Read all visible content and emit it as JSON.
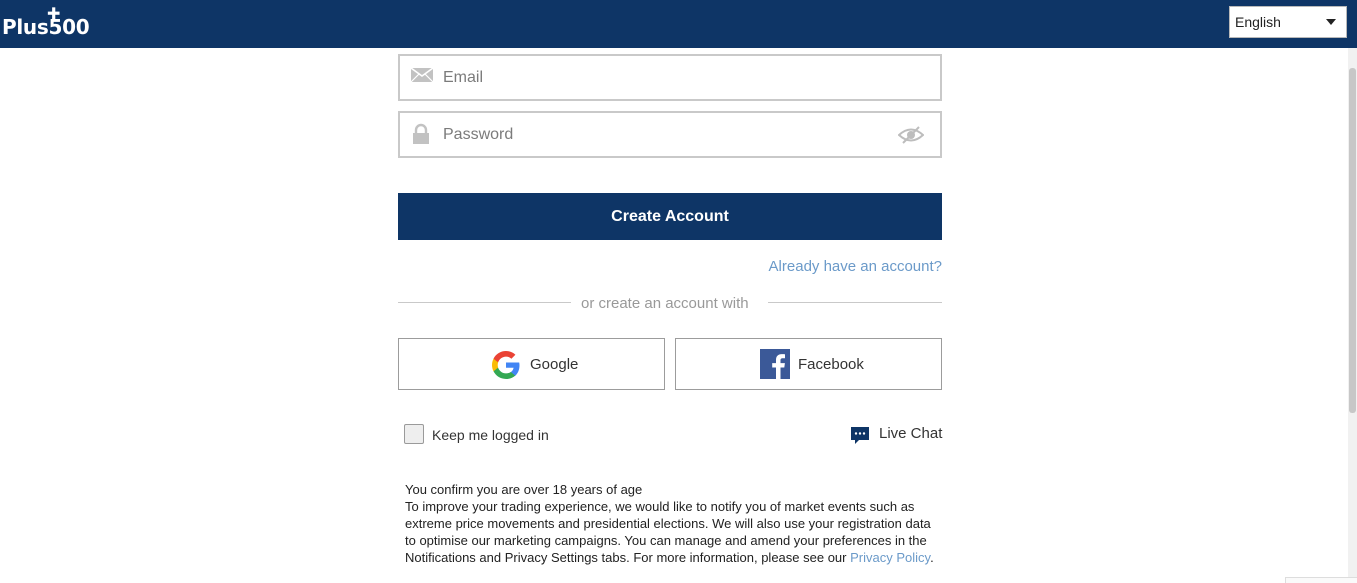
{
  "header": {
    "logo_text": "Plus500",
    "language_select": {
      "selected": "English"
    }
  },
  "form": {
    "email": {
      "placeholder": "Email",
      "value": ""
    },
    "password": {
      "placeholder": "Password",
      "value": ""
    },
    "create_button": "Create Account",
    "already_link": "Already have an account?",
    "divider_text": "or create an account with",
    "social": [
      {
        "label": "Google"
      },
      {
        "label": "Facebook"
      }
    ],
    "keep_logged_in": {
      "label": "Keep me logged in",
      "checked": false
    },
    "live_chat": "Live Chat"
  },
  "legal": {
    "line1": "You confirm you are over 18 years of age",
    "body": "To improve your trading experience, we would like to notify you of market events such as extreme price movements and presidential elections. We will also use your registration data to optimise our marketing campaigns. You can manage and amend your preferences in the Notifications and Privacy Settings tabs. For more information, please see our",
    "link": "Privacy Policy",
    "end": "."
  },
  "colors": {
    "brand_navy": "#0e3566",
    "link_blue": "#6b9ac9",
    "facebook_blue": "#3b5998"
  }
}
